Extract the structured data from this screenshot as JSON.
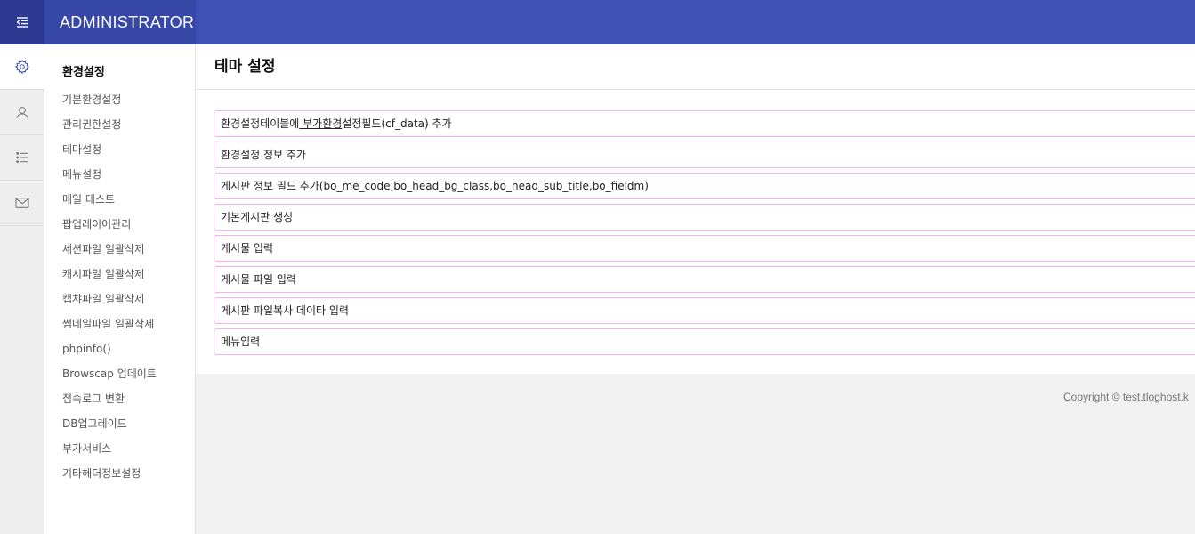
{
  "app": {
    "title": "ADMINISTRATOR",
    "accent": "#3f51b5"
  },
  "iconbar": [
    {
      "icon": "gear-icon",
      "active": true
    },
    {
      "icon": "user-icon",
      "active": false
    },
    {
      "icon": "list-icon",
      "active": false
    },
    {
      "icon": "mail-icon",
      "active": false
    }
  ],
  "sidebar": {
    "title": "환경설정",
    "items": [
      {
        "label": "기본환경설정"
      },
      {
        "label": "관리권한설정"
      },
      {
        "label": "테마설정"
      },
      {
        "label": "메뉴설정"
      },
      {
        "label": "메일 테스트"
      },
      {
        "label": "팝업레이어관리"
      },
      {
        "label": "세션파일 일괄삭제"
      },
      {
        "label": "캐시파일 일괄삭제"
      },
      {
        "label": "캡챠파일 일괄삭제"
      },
      {
        "label": "썸네일파일 일괄삭제"
      },
      {
        "label": "phpinfo()"
      },
      {
        "label": "Browscap 업데이트"
      },
      {
        "label": "접속로그 변환"
      },
      {
        "label": "DB업그레이드"
      },
      {
        "label": "부가서비스"
      },
      {
        "label": "기타헤더정보설정"
      }
    ]
  },
  "main": {
    "title": "테마 설정",
    "first_row": {
      "before": "환경설정테이블에",
      "underlined": " 부가환경",
      "after": "설정필드(cf_data) 추가"
    },
    "rows": [
      {
        "label": "환경설정 정보 추가"
      },
      {
        "label": "게시판 정보 필드 추가(bo_me_code,bo_head_bg_class,bo_head_sub_title,bo_fieldm)"
      },
      {
        "label": "기본게시판 생성"
      },
      {
        "label": "게시물 입력"
      },
      {
        "label": "게시물 파일 입력"
      },
      {
        "label": "게시판 파일복사 데이타 입력"
      },
      {
        "label": "메뉴입력"
      }
    ]
  },
  "footer": {
    "text": "Copyright © test.tloghost.k"
  }
}
